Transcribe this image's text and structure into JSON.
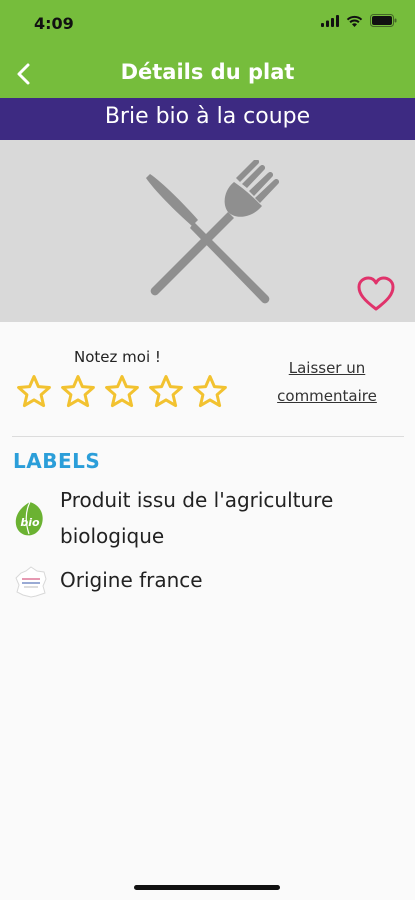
{
  "status_bar": {
    "time": "4:09"
  },
  "nav": {
    "title": "Détails du plat"
  },
  "dish": {
    "name": "Brie bio à la coupe"
  },
  "rating": {
    "prompt": "Notez moi !",
    "stars_total": 5,
    "stars_selected": 0,
    "comment_link": "Laisser un commentaire"
  },
  "labels": {
    "heading": "LABELS",
    "items": [
      {
        "icon": "bio-label-icon",
        "text": "Produit issu de l'agriculture biologique"
      },
      {
        "icon": "origine-france-icon",
        "text": "Origine france"
      }
    ]
  },
  "colors": {
    "header_green": "#76bd3c",
    "dish_bar_purple": "#3d2a82",
    "labels_blue": "#2b9ed9",
    "star_yellow": "#f2c230",
    "heart_pink": "#e0336b"
  }
}
